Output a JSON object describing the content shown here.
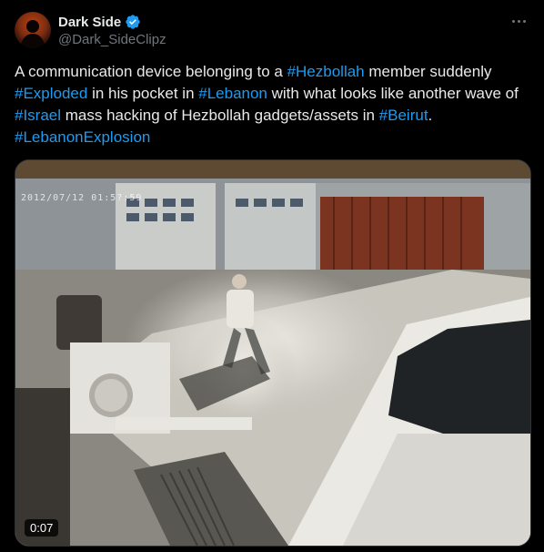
{
  "author": {
    "display_name": "Dark Side",
    "handle": "@Dark_SideClipz",
    "verified_icon": "verified-badge-icon",
    "avatar_icon": "avatar-silhouette"
  },
  "menu": {
    "icon": "more-horizontal-icon"
  },
  "tweet": {
    "segments": [
      {
        "text": "A communication device belonging to a ",
        "tag": false
      },
      {
        "text": "#Hezbollah",
        "tag": true
      },
      {
        "text": " member suddenly ",
        "tag": false
      },
      {
        "text": "#Exploded",
        "tag": true
      },
      {
        "text": " in his pocket in ",
        "tag": false
      },
      {
        "text": "#Lebanon",
        "tag": true
      },
      {
        "text": " with what looks like another wave of ",
        "tag": false
      },
      {
        "text": "#Israel",
        "tag": true
      },
      {
        "text": " mass hacking of Hezbollah gadgets/assets in ",
        "tag": false
      },
      {
        "text": "#Beirut",
        "tag": true
      },
      {
        "text": ". ",
        "tag": false
      },
      {
        "text": "#LebanonExplosion",
        "tag": true
      }
    ]
  },
  "media": {
    "duration": "0:07",
    "cctv_timestamp": "2012/07/12 01:5?:59"
  },
  "colors": {
    "background": "#000000",
    "text": "#e7e9ea",
    "muted": "#71767b",
    "link": "#1d9bf0",
    "verified": "#1d9bf0"
  }
}
